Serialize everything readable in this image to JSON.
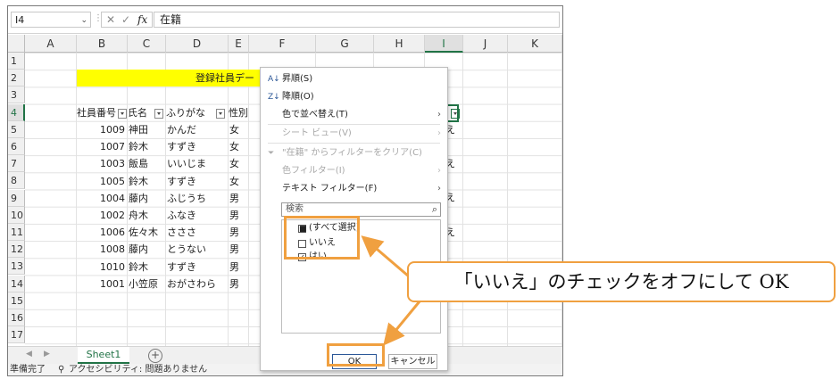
{
  "formula_bar": {
    "name_box": "I4",
    "formula": "在籍",
    "cancel_glyph": "✕",
    "enter_glyph": "✓",
    "fx_label": "fx"
  },
  "columns": [
    "A",
    "B",
    "C",
    "D",
    "E",
    "F",
    "G",
    "H",
    "I",
    "J",
    "K"
  ],
  "rows": [
    "1",
    "2",
    "3",
    "4",
    "5",
    "6",
    "7",
    "8",
    "9",
    "10",
    "11",
    "12",
    "13",
    "14",
    "15",
    "16",
    "17"
  ],
  "title_cell": "登録社員デー",
  "headers": {
    "id": "社員番号",
    "name": "氏名",
    "kana": "ふりがな",
    "sex": "性別"
  },
  "table_rows": [
    {
      "id": "1009",
      "name": "神田",
      "kana": "かんだ",
      "sex": "女"
    },
    {
      "id": "1007",
      "name": "鈴木",
      "kana": "すずき",
      "sex": "女"
    },
    {
      "id": "1003",
      "name": "飯島",
      "kana": "いいじま",
      "sex": "女"
    },
    {
      "id": "1005",
      "name": "鈴木",
      "kana": "すずき",
      "sex": "女"
    },
    {
      "id": "1004",
      "name": "藤内",
      "kana": "ふじうち",
      "sex": "男"
    },
    {
      "id": "1002",
      "name": "舟木",
      "kana": "ふなき",
      "sex": "男"
    },
    {
      "id": "1006",
      "name": "佐々木",
      "kana": "さささ",
      "sex": "男"
    },
    {
      "id": "1008",
      "name": "藤内",
      "kana": "とうない",
      "sex": "男"
    },
    {
      "id": "1010",
      "name": "鈴木",
      "kana": "すずき",
      "sex": "男"
    },
    {
      "id": "1001",
      "name": "小笠原",
      "kana": "おがさわら",
      "sex": "男"
    }
  ],
  "peek_cells": {
    "r5": "え",
    "r7": "え",
    "r9": "え",
    "r11": "え"
  },
  "sheet_tab": "Sheet1",
  "add_sheet": "+",
  "status": {
    "ready": "準備完了",
    "accessibility": "アクセシビリティ: 問題ありません"
  },
  "menu": {
    "sort_asc": "昇順(S)",
    "sort_desc": "降順(O)",
    "sort_color": "色で並べ替え(T)",
    "sheet_view": "シート ビュー(V)",
    "clear_filter": "\"在籍\" からフィルターをクリア(C)",
    "color_filter": "色フィルター(I)",
    "text_filter": "テキスト フィルター(F)",
    "search_placeholder": "検索",
    "items": [
      {
        "label": "(すべて選択)",
        "state": "partial"
      },
      {
        "label": "いいえ",
        "state": "unchecked"
      },
      {
        "label": "はい",
        "state": "checked"
      }
    ],
    "ok": "OK",
    "cancel": "キャンセル"
  },
  "callout": "「いいえ」のチェックをオフにして OK",
  "accent_color": "#f0a040"
}
